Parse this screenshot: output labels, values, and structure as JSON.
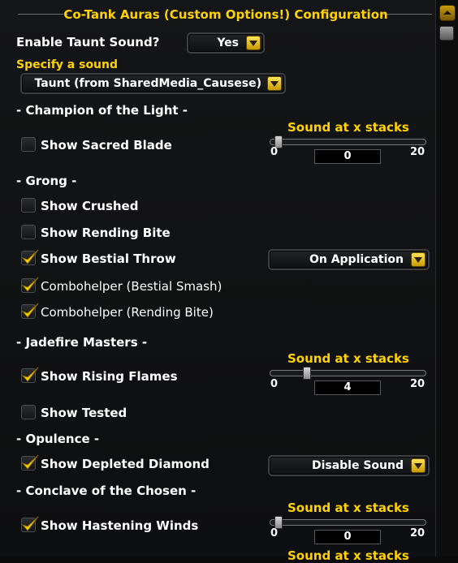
{
  "title": "Co-Tank Auras (Custom Options!) Configuration",
  "enable_taunt": {
    "label": "Enable Taunt Sound?",
    "value": "Yes"
  },
  "sound_select": {
    "label": "Specify a sound",
    "value": "Taunt (from SharedMedia_Causese)"
  },
  "sections": {
    "champion": "- Champion of the Light -",
    "grong": "- Grong -",
    "jadefire": "- Jadefire Masters -",
    "opulence": "- Opulence -",
    "conclave": "- Conclave of the Chosen -"
  },
  "options": {
    "sacred_blade": {
      "label": "Show Sacred Blade",
      "checked": false
    },
    "crushed": {
      "label": "Show Crushed",
      "checked": false
    },
    "rending_bite": {
      "label": "Show Rending Bite",
      "checked": false
    },
    "bestial_throw": {
      "label": "Show Bestial Throw",
      "checked": true
    },
    "combo_smash": {
      "label": "Combohelper (Bestial Smash)",
      "checked": true
    },
    "combo_bite": {
      "label": "Combohelper (Rending Bite)",
      "checked": true
    },
    "rising_flames": {
      "label": "Show Rising Flames",
      "checked": true
    },
    "tested": {
      "label": "Show Tested",
      "checked": false
    },
    "depleted_diamond": {
      "label": "Show Depleted Diamond",
      "checked": true
    },
    "hastening_winds": {
      "label": "Show Hastening Winds",
      "checked": true
    }
  },
  "dropdowns": {
    "bestial_throw": "On Application",
    "depleted_diamond": "Disable Sound"
  },
  "sliders": {
    "sacred_blade": {
      "label": "Sound at x stacks",
      "min": "0",
      "max": "20",
      "value": "0"
    },
    "rising_flames": {
      "label": "Sound at x stacks",
      "min": "0",
      "max": "20",
      "value": "4"
    },
    "hastening_winds": {
      "label": "Sound at x stacks",
      "min": "0",
      "max": "20",
      "value": "0"
    },
    "next": {
      "label": "Sound at x stacks"
    }
  },
  "icons": {
    "dropdown": "chevron-down-icon",
    "check": "checkmark-icon",
    "scroll_up": "scroll-up-icon"
  },
  "colors": {
    "accent": "#ffd200",
    "text": "#ffffff",
    "panel": "#121314"
  }
}
